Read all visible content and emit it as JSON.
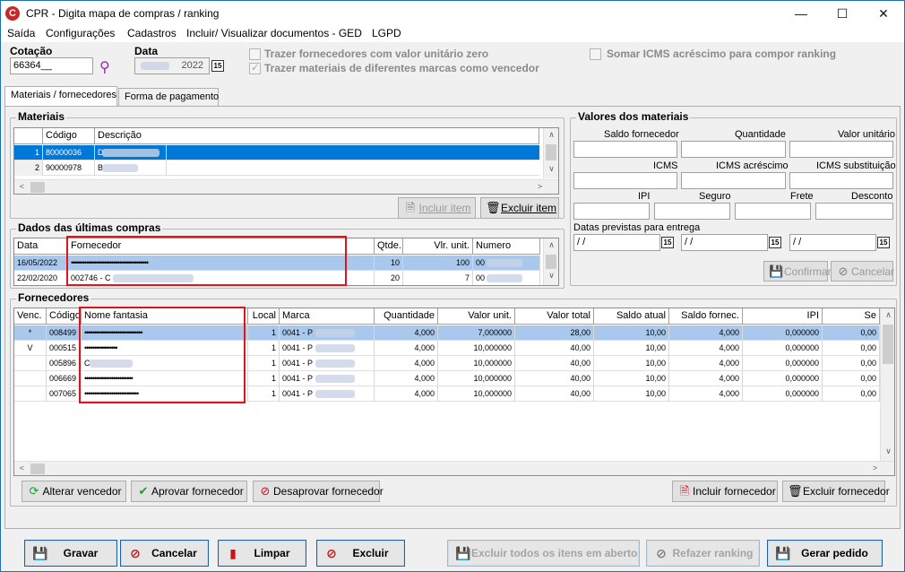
{
  "window": {
    "title": "CPR - Digita mapa de compras / ranking",
    "app_icon": "C"
  },
  "menu": [
    "Saída",
    "Configurações",
    "Cadastros",
    "Incluir/ Visualizar documentos - GED",
    "LGPD"
  ],
  "header": {
    "cotacao_label": "Cotação",
    "cotacao_value": "66364__",
    "data_label": "Data",
    "data_value": "2022",
    "cal_icon_text": "15",
    "chk_valor_zero": "Trazer fornecedores com valor unitário zero",
    "chk_marcas": "Trazer materiais de diferentes marcas como vencedor",
    "chk_icms": "Somar ICMS acréscimo para compor ranking"
  },
  "tabs": [
    "Materiais / fornecedores",
    "Forma de pagamento"
  ],
  "materiais": {
    "title": "Materiais",
    "columns": [
      "Código",
      "Descrição"
    ],
    "rows": [
      {
        "n": "1",
        "codigo": "80000036",
        "descricao": "D"
      },
      {
        "n": "2",
        "codigo": "90000978",
        "descricao": "B"
      }
    ],
    "btn_incluir": "Incluir item",
    "btn_excluir": "Excluir item"
  },
  "valores": {
    "title": "Valores dos materiais",
    "labels": {
      "saldo": "Saldo fornecedor",
      "quantidade": "Quantidade",
      "valor_unit": "Valor unitário",
      "icms": "ICMS",
      "icms_acr": "ICMS acréscimo",
      "icms_sub": "ICMS substituição",
      "ipi": "IPI",
      "seguro": "Seguro",
      "frete": "Frete",
      "desconto": "Desconto",
      "datas": "Datas previstas para entrega"
    },
    "dates": [
      " / /",
      " / /",
      " / /"
    ],
    "btn_confirmar": "Confirmar",
    "btn_cancelar": "Cancelar"
  },
  "ultimas": {
    "title": "Dados das últimas compras",
    "columns": [
      "Data",
      "Fornecedor",
      "Qtde.",
      "Vlr. unit.",
      "Numero"
    ],
    "rows": [
      {
        "data": "16/05/2022",
        "fornecedor": "••••••••••••••••••••••••••••••••••••••••",
        "qtde": "10",
        "vlr": "100",
        "numero": "00"
      },
      {
        "data": "22/02/2020",
        "fornecedor": "002746 - C",
        "qtde": "20",
        "vlr": "7",
        "numero": "00"
      }
    ]
  },
  "fornecedores": {
    "title": "Fornecedores",
    "columns": [
      "Venc.",
      "Código",
      "Nome fantasia",
      "Local",
      "Marca",
      "Quantidade",
      "Valor unit.",
      "Valor total",
      "Saldo atual",
      "Saldo fornec.",
      "IPI",
      "Se"
    ],
    "rows": [
      {
        "venc": "*",
        "codigo": "008499",
        "nome": "••••••••••••••••••••••••••••••",
        "local": "1",
        "marca": "0041 - P",
        "qtd": "4,000",
        "vunit": "7,000000",
        "vtotal": "28,00",
        "saldo": "10,00",
        "sforn": "4,000",
        "ipi": "0,000000",
        "se": "0,00"
      },
      {
        "venc": "V",
        "codigo": "000515",
        "nome": "•••••••••••••••••",
        "local": "1",
        "marca": "0041 - P",
        "qtd": "4,000",
        "vunit": "10,000000",
        "vtotal": "40,00",
        "saldo": "10,00",
        "sforn": "4,000",
        "ipi": "0,000000",
        "se": "0,00"
      },
      {
        "venc": "",
        "codigo": "005896",
        "nome": "C",
        "local": "1",
        "marca": "0041 - P",
        "qtd": "4,000",
        "vunit": "10,000000",
        "vtotal": "40,00",
        "saldo": "10,00",
        "sforn": "4,000",
        "ipi": "0,000000",
        "se": "0,00"
      },
      {
        "venc": "",
        "codigo": "006669",
        "nome": "•••••••••••••••••••••••••",
        "local": "1",
        "marca": "0041 - P",
        "qtd": "4,000",
        "vunit": "10,000000",
        "vtotal": "40,00",
        "saldo": "10,00",
        "sforn": "4,000",
        "ipi": "0,000000",
        "se": "0,00"
      },
      {
        "venc": "",
        "codigo": "007065",
        "nome": "••••••••••••••••••••••••••••",
        "local": "1",
        "marca": "0041 - P",
        "qtd": "4,000",
        "vunit": "10,000000",
        "vtotal": "40,00",
        "saldo": "10,00",
        "sforn": "4,000",
        "ipi": "0,000000",
        "se": "0,00"
      }
    ],
    "btn_alterar": "Alterar vencedor",
    "btn_aprovar": "Aprovar fornecedor",
    "btn_desaprovar": "Desaprovar fornecedor",
    "btn_incluir": "Incluir fornecedor",
    "btn_excluir": "Excluir fornecedor"
  },
  "footer": {
    "gravar": "Gravar",
    "cancelar": "Cancelar",
    "limpar": "Limpar",
    "excluir": "Excluir",
    "excluir_todos": "Excluir todos os itens em aberto",
    "refazer": "Refazer ranking",
    "gerar": "Gerar pedido"
  }
}
